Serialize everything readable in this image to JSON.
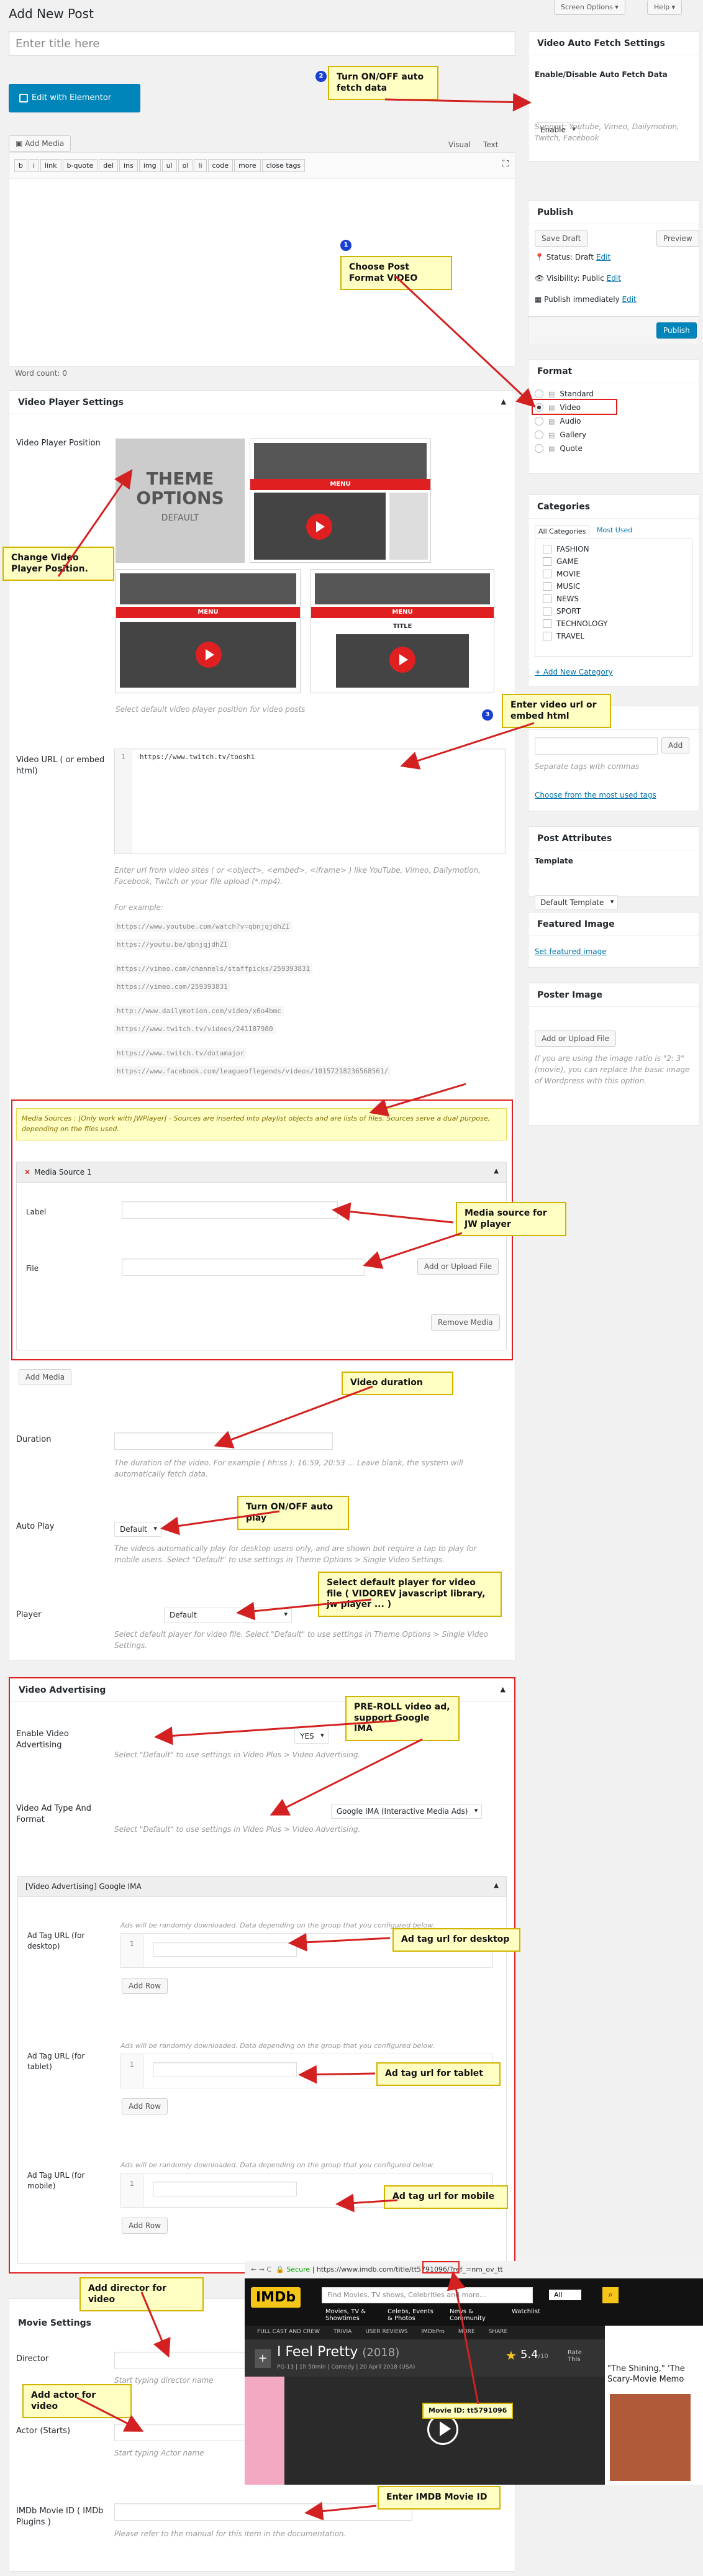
{
  "page": {
    "title": "Add New Post",
    "screen_options": "Screen Options ▾",
    "help": "Help ▾"
  },
  "editor": {
    "title_placeholder": "Enter title here",
    "elementor_btn": "Edit with Elementor",
    "add_media": "Add Media",
    "tab_visual": "Visual",
    "tab_text": "Text",
    "toolbar": [
      "b",
      "i",
      "link",
      "b-quote",
      "del",
      "ins",
      "img",
      "ul",
      "ol",
      "li",
      "code",
      "more",
      "close tags"
    ],
    "word_count": "Word count: 0"
  },
  "video_settings": {
    "title": "Video Player Settings",
    "position_label": "Video Player Position",
    "theme_options": "THEME OPTIONS",
    "default": "DEFAULT",
    "menu": "MENU",
    "title_tag": "TITLE",
    "position_desc": "Select default video player position for video posts",
    "url_label": "Video URL ( or embed html)",
    "url_line": "1",
    "url_value": "https://www.twitch.tv/tooshi",
    "url_desc": "Enter url from video sites ( or <object>, <embed>, <iframe> ) like YouTube, Vimeo, Dailymotion, Facebook, Twitch or your file upload (*.mp4).",
    "example_label": "For example:",
    "examples": [
      "https://www.youtube.com/watch?v=qbnjqjdhZI",
      "https://youtu.be/qbnjqjdhZI",
      "https://vimeo.com/channels/staffpicks/259393831",
      "https://vimeo.com/259393831",
      "http://www.dailymotion.com/video/x6o4bmc",
      "https://www.twitch.tv/videos/241187980",
      "https://www.twitch.tv/dotamajor",
      "https://www.facebook.com/leagueoflegends/videos/10157218236568561/"
    ],
    "media_note": "Media Sources : [Only work with JWPlayer] - Sources are inserted into playlist objects and are lists of files. Sources serve a dual purpose, depending on the files used.",
    "media_source_title": "Media Source 1",
    "media_label": "Label",
    "media_file": "File",
    "upload_btn": "Add or Upload File",
    "remove_btn": "Remove Media",
    "add_media_btn": "Add Media",
    "duration_label": "Duration",
    "duration_desc": "The duration of the video. For example ( hh:ss ): 16:59, 20:53 ... Leave blank, the system will automatically fetch data.",
    "autoplay_label": "Auto Play",
    "autoplay_value": "Default",
    "autoplay_desc": "The videos automatically play for desktop users only, and are shown but require a tap to play for mobile users. Select \"Default\" to use settings in Theme Options > Single Video Settings.",
    "player_label": "Player",
    "player_value": "Default",
    "player_desc": "Select default player for video file. Select \"Default\" to use settings in Theme Options > Single Video Settings."
  },
  "advertising": {
    "title": "Video Advertising",
    "enable_label": "Enable Video Advertising",
    "enable_value": "YES",
    "enable_desc": "Select \"Default\" to use settings in Video Plus > Video Advertising.",
    "type_label": "Video Ad Type And Format",
    "type_value": "Google IMA (Interactive Media Ads)",
    "type_desc": "Select \"Default\" to use settings in Video Plus > Video Advertising.",
    "ima_title": "[Video Advertising] Google IMA",
    "desktop_label": "Ad Tag URL (for desktop)",
    "tablet_label": "Ad Tag URL (for tablet)",
    "mobile_label": "Ad Tag URL (for mobile)",
    "tag_desc": "Ads will be randomly downloaded. Data depending on the group that you configured below.",
    "row_num": "1",
    "add_row": "Add Row"
  },
  "movie": {
    "title": "Movie Settings",
    "director_label": "Director",
    "director_placeholder": "Start typing director name",
    "actor_label": "Actor (Starts)",
    "actor_placeholder": "Start typing Actor name",
    "imdb_label": "IMDb Movie ID ( IMDb Plugins )",
    "imdb_desc": "Please refer to the manual for this item in the documentation."
  },
  "imdb_shot": {
    "url_secure": "Secure",
    "url": "https://www.imdb.com/title/tt5791096/?ref_=nm_ov_tt",
    "logo": "IMDb",
    "search_placeholder": "Find Movies, TV shows, Celebrities and more...",
    "search_all": "All",
    "nav": [
      "Movies, TV & Showtimes",
      "Celebs, Events & Photos",
      "News & Community",
      "Watchlist"
    ],
    "sub_nav": [
      "FULL CAST AND CREW",
      "TRIVIA",
      "USER REVIEWS",
      "IMDbPro",
      "MORE",
      "SHARE"
    ],
    "movie_title": "I Feel Pretty",
    "year": "(2018)",
    "meta": "PG-13 | 1h 50min | Comedy | 20 April 2018 (USA)",
    "rating": "5.4",
    "rating_suffix": "/10",
    "rate_this": "Rate This",
    "side_caption": "\"The Shining,\" 'The Scary-Movie Memo",
    "movie_id": "Movie ID: tt5791096"
  },
  "sidebar": {
    "fetch_title": "Video Auto Fetch Settings",
    "fetch_label": "Enable/Disable Auto Fetch Data",
    "fetch_value": "Enable",
    "fetch_desc": "Support: Youtube, Vimeo, Dailymotion, Twitch, Facebook",
    "publish_title": "Publish",
    "save_draft": "Save Draft",
    "preview": "Preview",
    "status": "Status: Draft",
    "visibility": "Visibility: Public",
    "publish_when": "Publish immediately",
    "edit": "Edit",
    "publish_btn": "Publish",
    "format_title": "Format",
    "formats": [
      "Standard",
      "Video",
      "Audio",
      "Gallery",
      "Quote"
    ],
    "categories_title": "Categories",
    "cat_tab_all": "All Categories",
    "cat_tab_used": "Most Used",
    "categories": [
      "FASHION",
      "GAME",
      "MOVIE",
      "MUSIC",
      "NEWS",
      "SPORT",
      "TECHNOLOGY",
      "TRAVEL"
    ],
    "add_category": "+ Add New Category",
    "tags_title": "Tags",
    "add_btn": "Add",
    "tags_desc": "Separate tags with commas",
    "tags_link": "Choose from the most used tags",
    "attr_title": "Post Attributes",
    "template_label": "Template",
    "template_value": "Default Template",
    "featured_title": "Featured Image",
    "featured_link": "Set featured image",
    "poster_title": "Poster Image",
    "poster_btn": "Add or Upload File",
    "poster_desc": "If you are using the image ratio is \"2: 3\" (movie), you can replace the basic image of Wordpress with this option."
  },
  "notes": {
    "fetch": "Turn ON/OFF auto fetch data",
    "format": "Choose Post Format VIDEO",
    "position": "Change Video Player Position.",
    "url": "Enter video url or embed html",
    "media": "Media source for JW player",
    "duration": "Video duration",
    "autoplay": "Turn ON/OFF auto play",
    "player": "Select default player for video file ( VIDOREV javascript library, jw player ... )",
    "preroll": "PRE-ROLL video ad, support Google IMA",
    "desktop": "Ad tag url for desktop",
    "tablet": "Ad tag url for tablet",
    "mobile": "Ad tag url for mobile",
    "director": "Add director for video",
    "actor": "Add actor for video",
    "imdb": "Enter IMDB Movie ID"
  },
  "badges": [
    "2",
    "1",
    "3"
  ],
  "colors": {
    "accent": "#0073aa",
    "note_bg": "#ffffc4",
    "arrow": "#d32020",
    "elementor": "#0085ba"
  }
}
